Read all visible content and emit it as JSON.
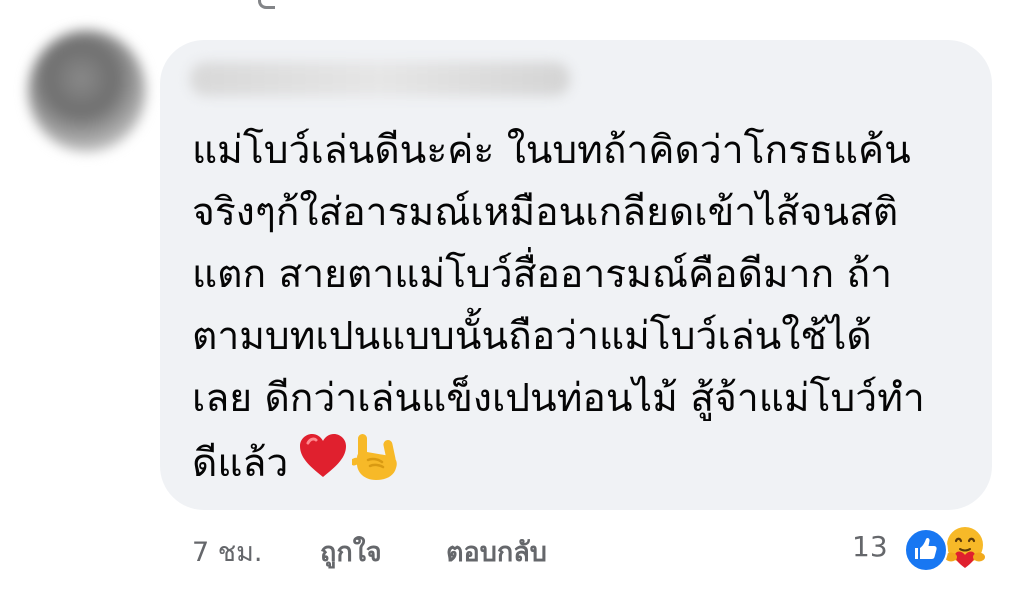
{
  "comment": {
    "author_name": "",
    "text_lines": [
      "แม่โบว์เล่นดีนะค่ะ ในบทถ้าคิดว่าโกรธแค้น",
      "จริงๆก้ใส่อารมณ์เหมือนเกลียดเข้าไส้จนสติ",
      "แตก สายตาแม่โบว์สื่ออารมณ์คือดีมาก ถ้า",
      "ตามบทเปนแบบนั้นถือว่าแม่โบว์เล่นใช้ได้",
      "เลย ดีกว่าเล่นแข็งเปนท่อนไม้ สู้จ้าแม่โบว์ทำ",
      "ดีแล้ว"
    ],
    "emoji": [
      "heart-icon",
      "rock-hand-icon"
    ]
  },
  "actions": {
    "timestamp": "7 ชม.",
    "like_label": "ถูกใจ",
    "reply_label": "ตอบกลับ"
  },
  "reactions": {
    "count": "13",
    "icons": [
      "like-reaction-icon",
      "care-reaction-icon"
    ]
  },
  "colors": {
    "bubble_bg": "#f0f2f5",
    "text": "#050505",
    "secondary_text": "#65676b",
    "like_blue": "#1877f2",
    "heart_red": "#e0202e",
    "emoji_yellow": "#f7b928"
  }
}
